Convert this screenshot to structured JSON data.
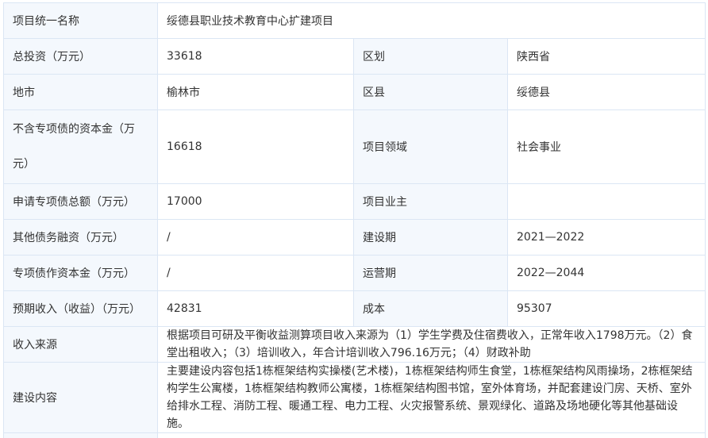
{
  "rows": {
    "project_name": {
      "label": "项目统一名称",
      "value": "绥德县职业技术教育中心扩建项目"
    },
    "total_investment": {
      "label": "总投资（万元）",
      "value": "33618"
    },
    "region": {
      "label": "区划",
      "value": "陕西省"
    },
    "city": {
      "label": "地市",
      "value": "榆林市"
    },
    "county": {
      "label": "区县",
      "value": "绥德县"
    },
    "capital_excl": {
      "label": "不含专项债的资本金（万元）",
      "value": "16618"
    },
    "field": {
      "label": "项目领域",
      "value": "社会事业"
    },
    "bond_total": {
      "label": "申请专项债总额（万元）",
      "value": "17000"
    },
    "owner": {
      "label": "项目业主",
      "value": ""
    },
    "other_debt": {
      "label": "其他债务融资（万元）",
      "value": "/"
    },
    "build_period": {
      "label": "建设期",
      "value": "2021—2022"
    },
    "bond_capital": {
      "label": "专项债作资本金（万元）",
      "value": "/"
    },
    "operate_period": {
      "label": "运营期",
      "value": "2022—2044"
    },
    "expected_income": {
      "label": "预期收入（收益）（万元）",
      "value": "42831"
    },
    "cost": {
      "label": "成本",
      "value": "95307"
    },
    "income_source": {
      "label": "收入来源",
      "value": "根据项目可研及平衡收益测算项目收入来源为（1）学生学费及住宿费收入，正常年收入1798万元。（2）食堂出租收入；（3）培训收入，年合计培训收入796.16万元；（4）财政补助"
    },
    "construction": {
      "label": "建设内容",
      "value": "主要建设内容包括1栋框架结构实操楼(艺术楼)，1栋框架结构师生食堂，1栋框架结构风雨操场，2栋框架结构学生公寓楼，1栋框架结构教师公寓楼，1栋框架结构图书馆，室外体育场，并配套建设门房、天桥、室外给排水工程、消防工程、暖通工程、电力工程、火灾报警系统、景观绿化、道路及场地硬化等其他基础设施。"
    }
  }
}
